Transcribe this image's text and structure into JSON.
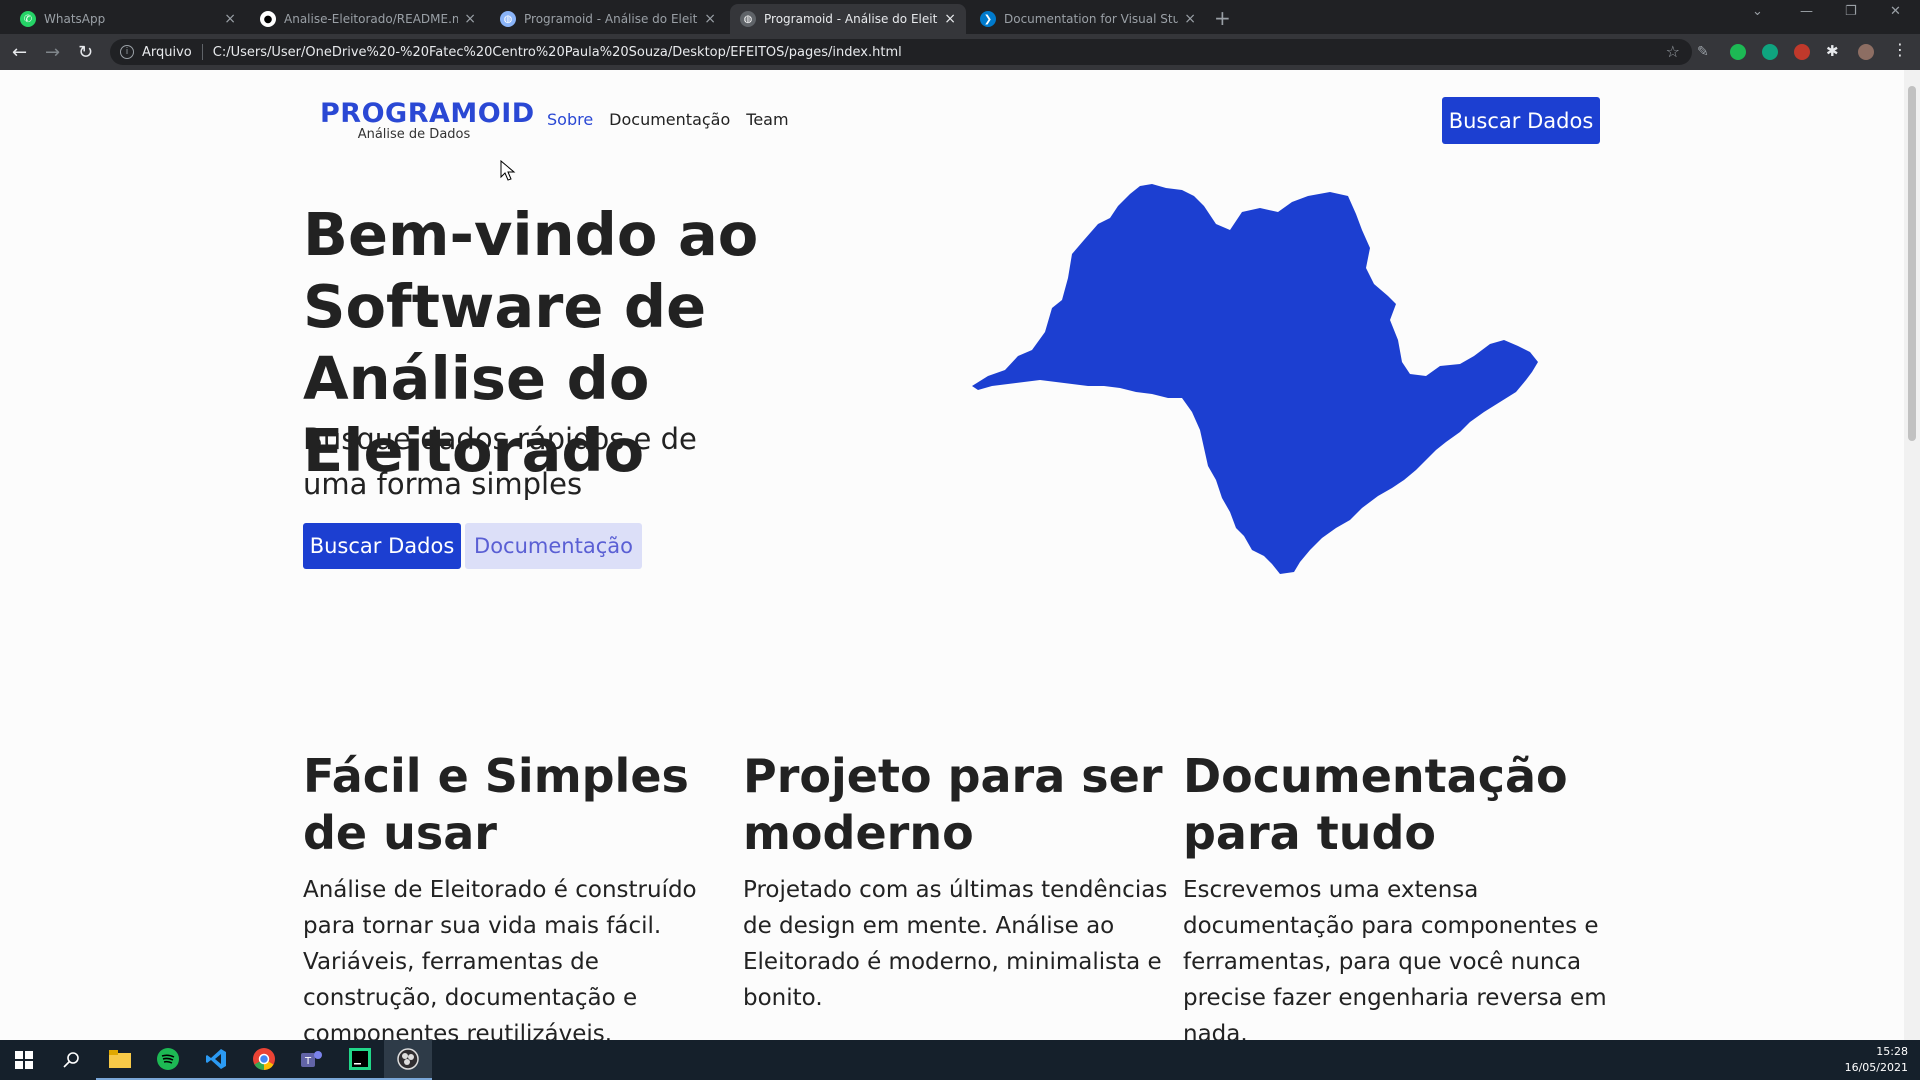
{
  "browser": {
    "tabs": [
      {
        "label": "WhatsApp",
        "icon": "whatsapp-icon",
        "active": false
      },
      {
        "label": "Analise-Eleitorado/README.md",
        "icon": "github-icon",
        "active": false
      },
      {
        "label": "Programoid - Análise do Eleitora",
        "icon": "globe-icon",
        "active": false
      },
      {
        "label": "Programoid - Análise do Eleitora",
        "icon": "globe-icon",
        "active": true
      },
      {
        "label": "Documentation for Visual Studio",
        "icon": "vscode-icon",
        "active": false
      }
    ],
    "security_label": "Arquivo",
    "url": "C:/Users/User/OneDrive%20-%20Fatec%20Centro%20Paula%20Souza/Desktop/EFEITOS/pages/index.html"
  },
  "page": {
    "brand": {
      "name": "PROGRAMOID",
      "subtitle": "Análise de Dados"
    },
    "nav": [
      "Sobre",
      "Documentação",
      "Team"
    ],
    "nav_cta": "Buscar Dados",
    "hero": {
      "title": "Bem-vindo ao Software de Análise do Eleitorado",
      "subtitle": "Busque dados rápidos e de uma forma simples",
      "primary_button": "Buscar Dados",
      "secondary_button": "Documentação"
    },
    "features": [
      {
        "title": "Fácil e Simples de usar",
        "body": "Análise de Eleitorado é construído para tornar sua vida mais fácil. Variáveis, ferramentas de construção, documentação e componentes reutilizáveis."
      },
      {
        "title": "Projeto para ser moderno",
        "body": "Projetado com as últimas tendências de design em mente. Análise ao Eleitorado é moderno, minimalista e bonito."
      },
      {
        "title": "Documentação para tudo",
        "body": "Escrevemos uma extensa documentação para componentes e ferramentas, para que você nunca precise fazer engenharia reversa em nada."
      }
    ],
    "map_color": "#1c3fd1"
  },
  "taskbar": {
    "time": "15:28",
    "date": "16/05/2021",
    "apps": [
      "windows-start-icon",
      "search-icon",
      "file-explorer-icon",
      "spotify-icon",
      "vscode-icon",
      "chrome-icon",
      "teams-icon",
      "pycharm-icon",
      "obs-icon"
    ]
  }
}
